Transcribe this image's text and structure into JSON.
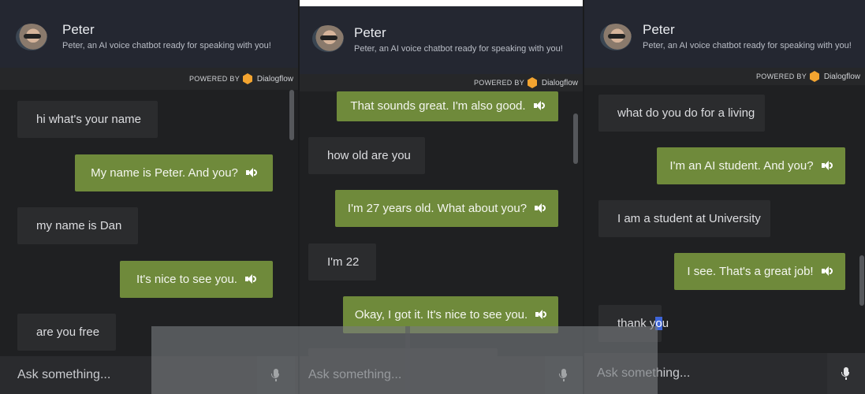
{
  "bot": {
    "name": "Peter",
    "subtitle": "Peter, an AI voice chatbot ready for speaking with you!"
  },
  "powered": {
    "label": "POWERED BY",
    "brand": "Dialogflow",
    "brand_color": "#f3a430"
  },
  "input": {
    "placeholder": "Ask something..."
  },
  "colors": {
    "bot_bubble": "#6f8a3b",
    "user_bubble": "#2b2c2e",
    "header": "#242731"
  },
  "panels": [
    {
      "messages": [
        {
          "role": "user",
          "text": "hi what's your name"
        },
        {
          "role": "bot",
          "text": "My name is Peter. And you?"
        },
        {
          "role": "user",
          "text": "my name is Dan"
        },
        {
          "role": "bot",
          "text": "It's nice to see you."
        },
        {
          "role": "user",
          "text": "are you free"
        }
      ]
    },
    {
      "messages": [
        {
          "role": "bot",
          "text": "That sounds great. I'm also good."
        },
        {
          "role": "user",
          "text": "how old are you"
        },
        {
          "role": "bot",
          "text": "I'm 27 years old. What about you?"
        },
        {
          "role": "user",
          "text": "I'm 22"
        },
        {
          "role": "bot",
          "text": "Okay, I got it. It's nice to see you."
        }
      ]
    },
    {
      "messages": [
        {
          "role": "user",
          "text": "what do you do for a living"
        },
        {
          "role": "bot",
          "text": "I'm an AI student. And you?"
        },
        {
          "role": "user",
          "text": "I am a student at University"
        },
        {
          "role": "bot",
          "text": "I see. That's a great job!"
        },
        {
          "role": "user",
          "text_before": "thank y",
          "text_highlight": "o",
          "text_after": "u"
        }
      ]
    }
  ]
}
